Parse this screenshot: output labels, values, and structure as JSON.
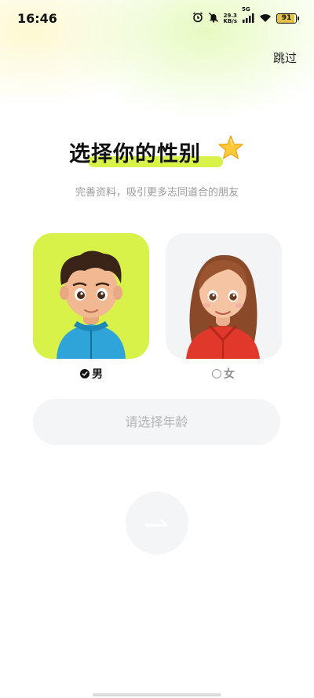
{
  "status_bar": {
    "time": "16:46",
    "net_speed_value": "29.3",
    "net_speed_unit": "KB/s",
    "network_type": "5G",
    "battery": "91",
    "icons": [
      "alarm-icon",
      "mute-icon",
      "signal-icon",
      "wifi-icon",
      "battery-icon"
    ]
  },
  "header": {
    "skip_label": "跳过"
  },
  "main": {
    "title": "选择你的性别",
    "subtitle": "完善资料，吸引更多志同道合的朋友",
    "genders": [
      {
        "label": "男",
        "selected": true,
        "avatar": "boy-avatar"
      },
      {
        "label": "女",
        "selected": false,
        "avatar": "girl-avatar"
      }
    ],
    "age_placeholder": "请选择年龄",
    "next_icon": "arrow-right-icon"
  },
  "colors": {
    "accent": "#d8f24a",
    "card_inactive": "#f3f4f6",
    "muted_text": "#9a9a9a"
  }
}
